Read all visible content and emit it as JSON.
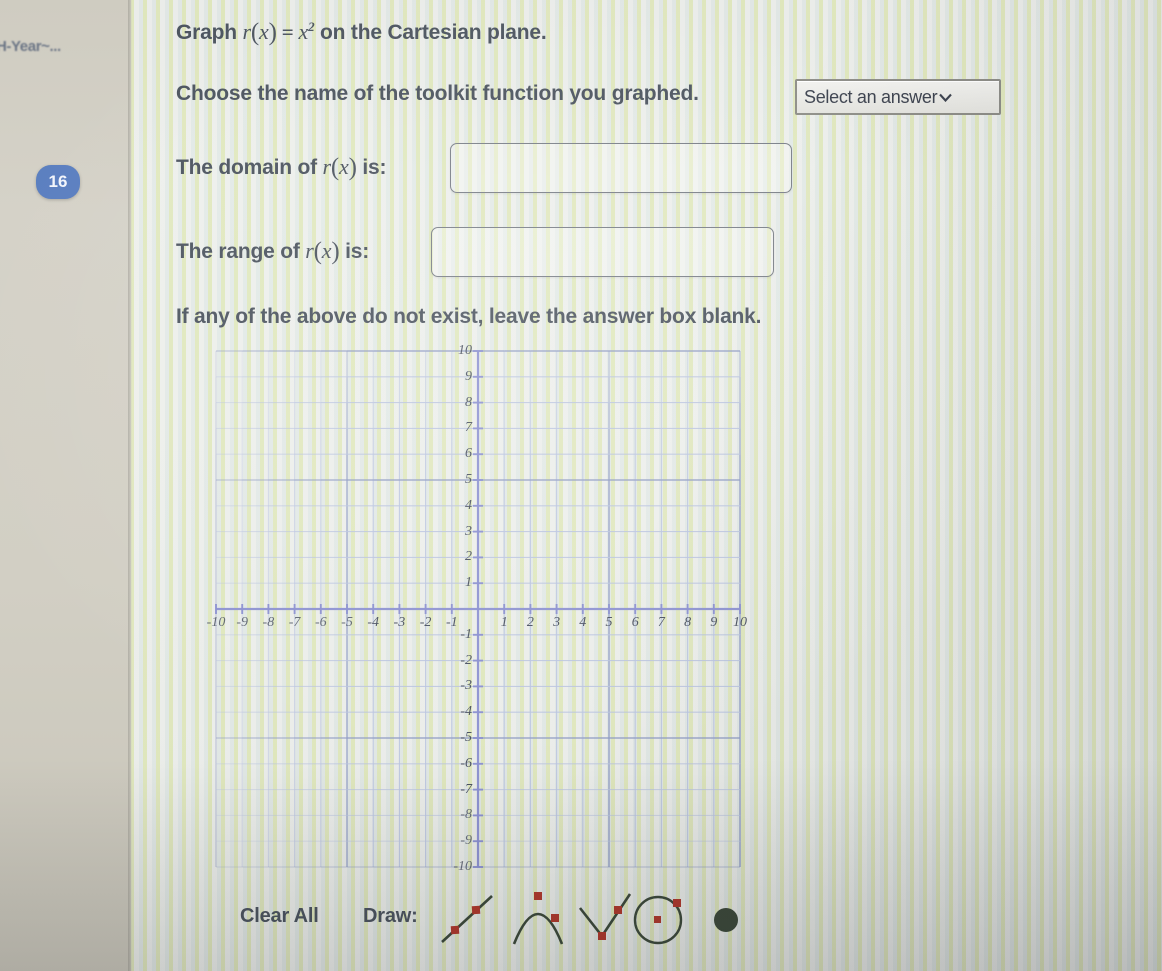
{
  "sidebar": {
    "title": "H-Year~...",
    "badge": "16"
  },
  "question": {
    "line1": {
      "prefix": "Graph ",
      "fn": "r",
      "arg": "x",
      "eq": "=",
      "base": "x",
      "power": "2",
      "suffix": " on the Cartesian plane."
    },
    "line2": "Choose the name of the toolkit function you graphed.",
    "line3": {
      "prefix": "The domain of ",
      "fn": "r",
      "arg": "x",
      "suffix": " is:"
    },
    "line4": {
      "prefix": "The range of ",
      "fn": "r",
      "arg": "x",
      "suffix": " is:"
    },
    "line5": "If any of the above do not exist, leave the answer box blank."
  },
  "select": {
    "label": "Select an answer",
    "chevron": "⌄"
  },
  "inputs": {
    "domain_value": "",
    "domain_placeholder": "",
    "range_value": "",
    "range_placeholder": ""
  },
  "tools": {
    "clear_all": "Clear All",
    "draw_label": "Draw:",
    "items": [
      {
        "name": "line-tool",
        "glyph": "line"
      },
      {
        "name": "parabola-tool",
        "glyph": "parabola"
      },
      {
        "name": "absolute-value-tool",
        "glyph": "vee"
      },
      {
        "name": "circle-tool",
        "glyph": "circle"
      },
      {
        "name": "point-tool",
        "glyph": "dot"
      }
    ]
  },
  "colors": {
    "badge": "#5b7fc0",
    "text": "#4d5560",
    "grid_minor": "#b9c3e0",
    "grid_major": "#8f9bc4",
    "axis": "#8a8fd0",
    "tool_stroke": "#3e4b3c",
    "tool_handle": "#b03a2e"
  },
  "chart_data": {
    "type": "scatter",
    "title": "",
    "xlabel": "",
    "ylabel": "",
    "xlim": [
      -10,
      10
    ],
    "ylim": [
      -10,
      10
    ],
    "grid": true,
    "legend": "none",
    "xticks": [
      -10,
      -9,
      -8,
      -7,
      -6,
      -5,
      -4,
      -3,
      -2,
      -1,
      1,
      2,
      3,
      4,
      5,
      6,
      7,
      8,
      9,
      10
    ],
    "yticks": [
      10,
      9,
      8,
      7,
      6,
      5,
      4,
      3,
      2,
      1,
      -1,
      -2,
      -3,
      -4,
      -5,
      -6,
      -7,
      -8,
      -9,
      -10
    ],
    "xtick_labels": [
      "-10",
      "-9",
      "-8",
      "-7",
      "-6",
      "-5",
      "-4",
      "-3",
      "-2",
      "-1",
      "1",
      "2",
      "3",
      "4",
      "5",
      "6",
      "7",
      "8",
      "9",
      "10"
    ],
    "ytick_labels": [
      "10",
      "9",
      "8",
      "7",
      "6",
      "5",
      "4",
      "3",
      "2",
      "1",
      "-1",
      "-2",
      "-3",
      "-4",
      "-5",
      "-6",
      "-7",
      "-8",
      "-9",
      "-10"
    ],
    "series": [],
    "values": [],
    "note": "Empty Cartesian grid: no curve has been drawn yet."
  }
}
